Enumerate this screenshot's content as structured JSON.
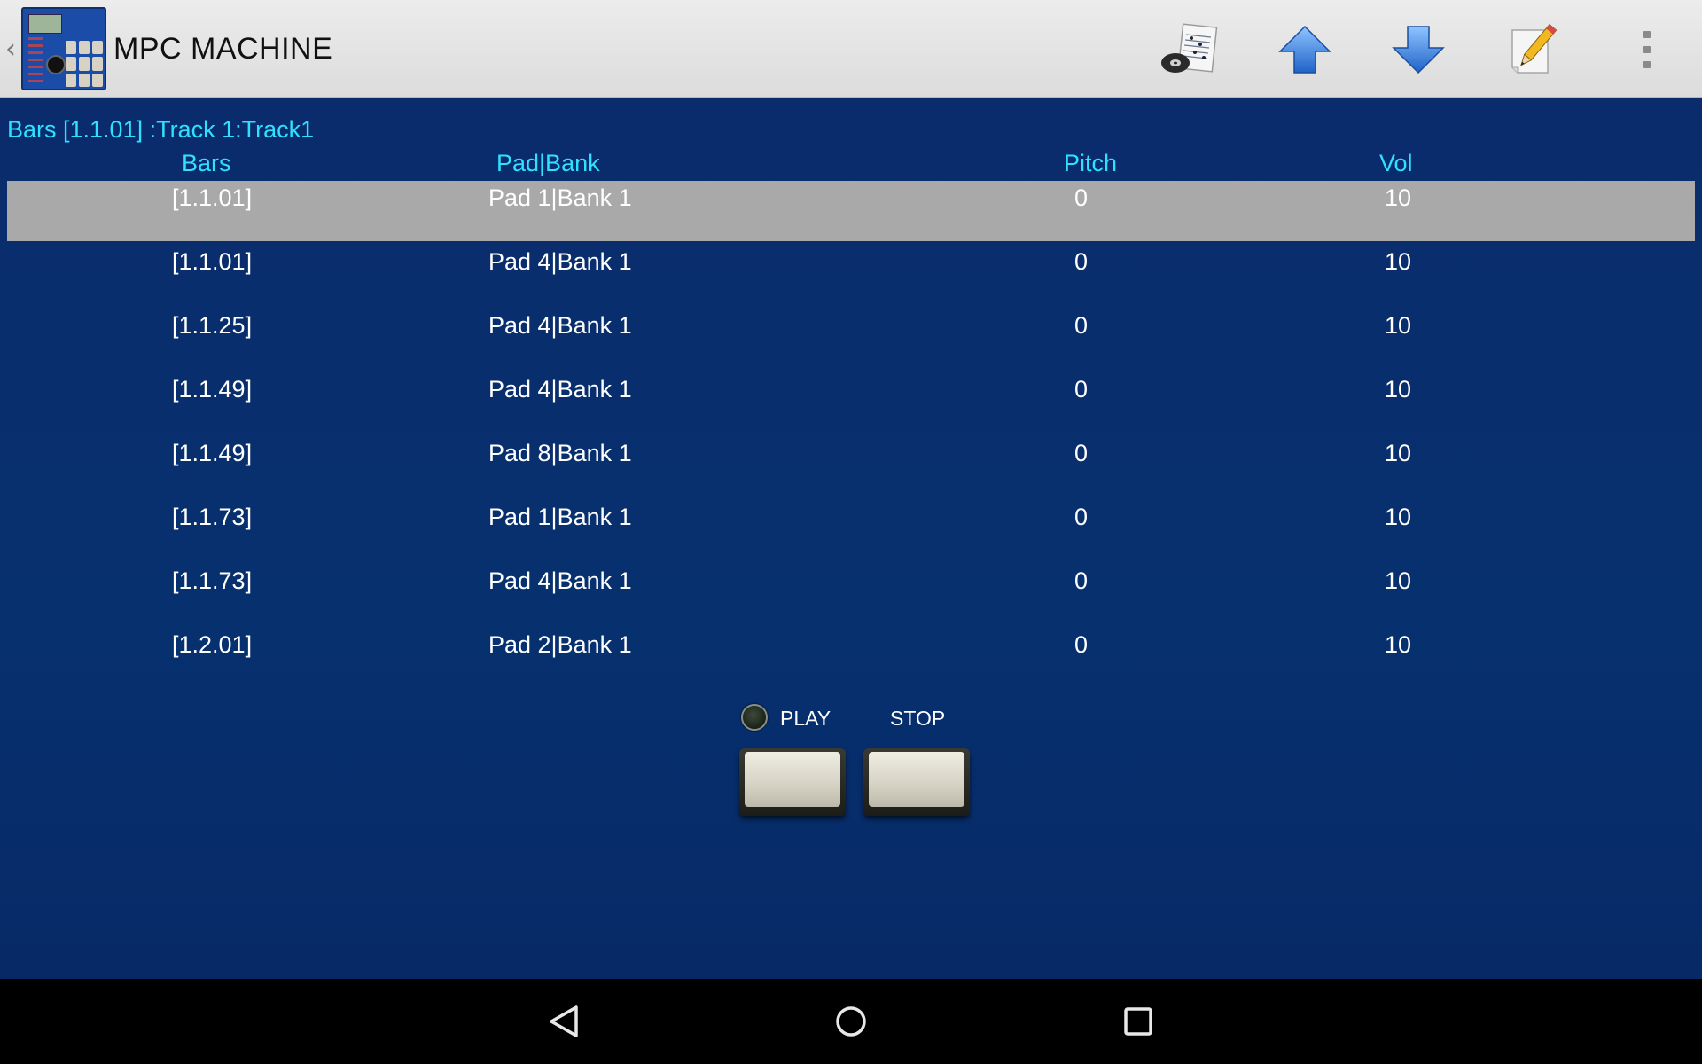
{
  "app": {
    "title": "MPC MACHINE"
  },
  "actionbar": {
    "icons": [
      "music-sheet-disc-icon",
      "arrow-up-icon",
      "arrow-down-icon",
      "pencil-edit-icon",
      "overflow-menu-icon"
    ]
  },
  "info": {
    "line": "Bars [1.1.01] :Track 1:Track1"
  },
  "table": {
    "headers": {
      "bars": "Bars",
      "pad_bank": "Pad|Bank",
      "pitch": "Pitch",
      "vol": "Vol"
    },
    "rows": [
      {
        "bars": "[1.1.01]",
        "pad_bank": "Pad 1|Bank 1",
        "pitch": "0",
        "vol": "10"
      },
      {
        "bars": "[1.1.01]",
        "pad_bank": "Pad 4|Bank 1",
        "pitch": "0",
        "vol": "10"
      },
      {
        "bars": "[1.1.25]",
        "pad_bank": "Pad 4|Bank 1",
        "pitch": "0",
        "vol": "10"
      },
      {
        "bars": "[1.1.49]",
        "pad_bank": "Pad 4|Bank 1",
        "pitch": "0",
        "vol": "10"
      },
      {
        "bars": "[1.1.49]",
        "pad_bank": "Pad 8|Bank 1",
        "pitch": "0",
        "vol": "10"
      },
      {
        "bars": "[1.1.73]",
        "pad_bank": "Pad 1|Bank 1",
        "pitch": "0",
        "vol": "10"
      },
      {
        "bars": "[1.1.73]",
        "pad_bank": "Pad 4|Bank 1",
        "pitch": "0",
        "vol": "10"
      },
      {
        "bars": "[1.2.01]",
        "pad_bank": "Pad 2|Bank 1",
        "pitch": "0",
        "vol": "10"
      }
    ],
    "selected_index": 0
  },
  "transport": {
    "play_label": "PLAY",
    "stop_label": "STOP"
  },
  "colors": {
    "background": "#082a66",
    "header_text": "#2fe0ff",
    "row_text": "#ffffff",
    "selected_row": "#a9a9a9",
    "actionbar": "#e4e4e4"
  },
  "navbar": {
    "icons": [
      "back-icon",
      "home-icon",
      "recents-icon"
    ]
  }
}
